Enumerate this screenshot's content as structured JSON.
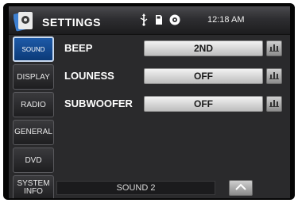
{
  "header": {
    "title": "SETTINGS",
    "clock": "12:18 AM",
    "status_icons": [
      "usb-icon",
      "sd-card-icon",
      "disc-icon"
    ]
  },
  "sidebar": {
    "items": [
      {
        "label": "SOUND",
        "active": true
      },
      {
        "label": "DISPLAY",
        "active": false
      },
      {
        "label": "RADIO",
        "active": false
      },
      {
        "label": "GENERAL",
        "active": false
      },
      {
        "label": "DVD",
        "active": false
      },
      {
        "label": "SYSTEM INFO",
        "active": false
      }
    ]
  },
  "settings": [
    {
      "label": "BEEP",
      "value": "2ND"
    },
    {
      "label": "LOUNESS",
      "value": "OFF"
    },
    {
      "label": "SUBWOOFER",
      "value": "OFF"
    }
  ],
  "footer": {
    "page_label": "SOUND 2"
  },
  "colors": {
    "accent": "#1d5aa8",
    "background": "#2a2a2c",
    "header": "#2e2e31"
  }
}
